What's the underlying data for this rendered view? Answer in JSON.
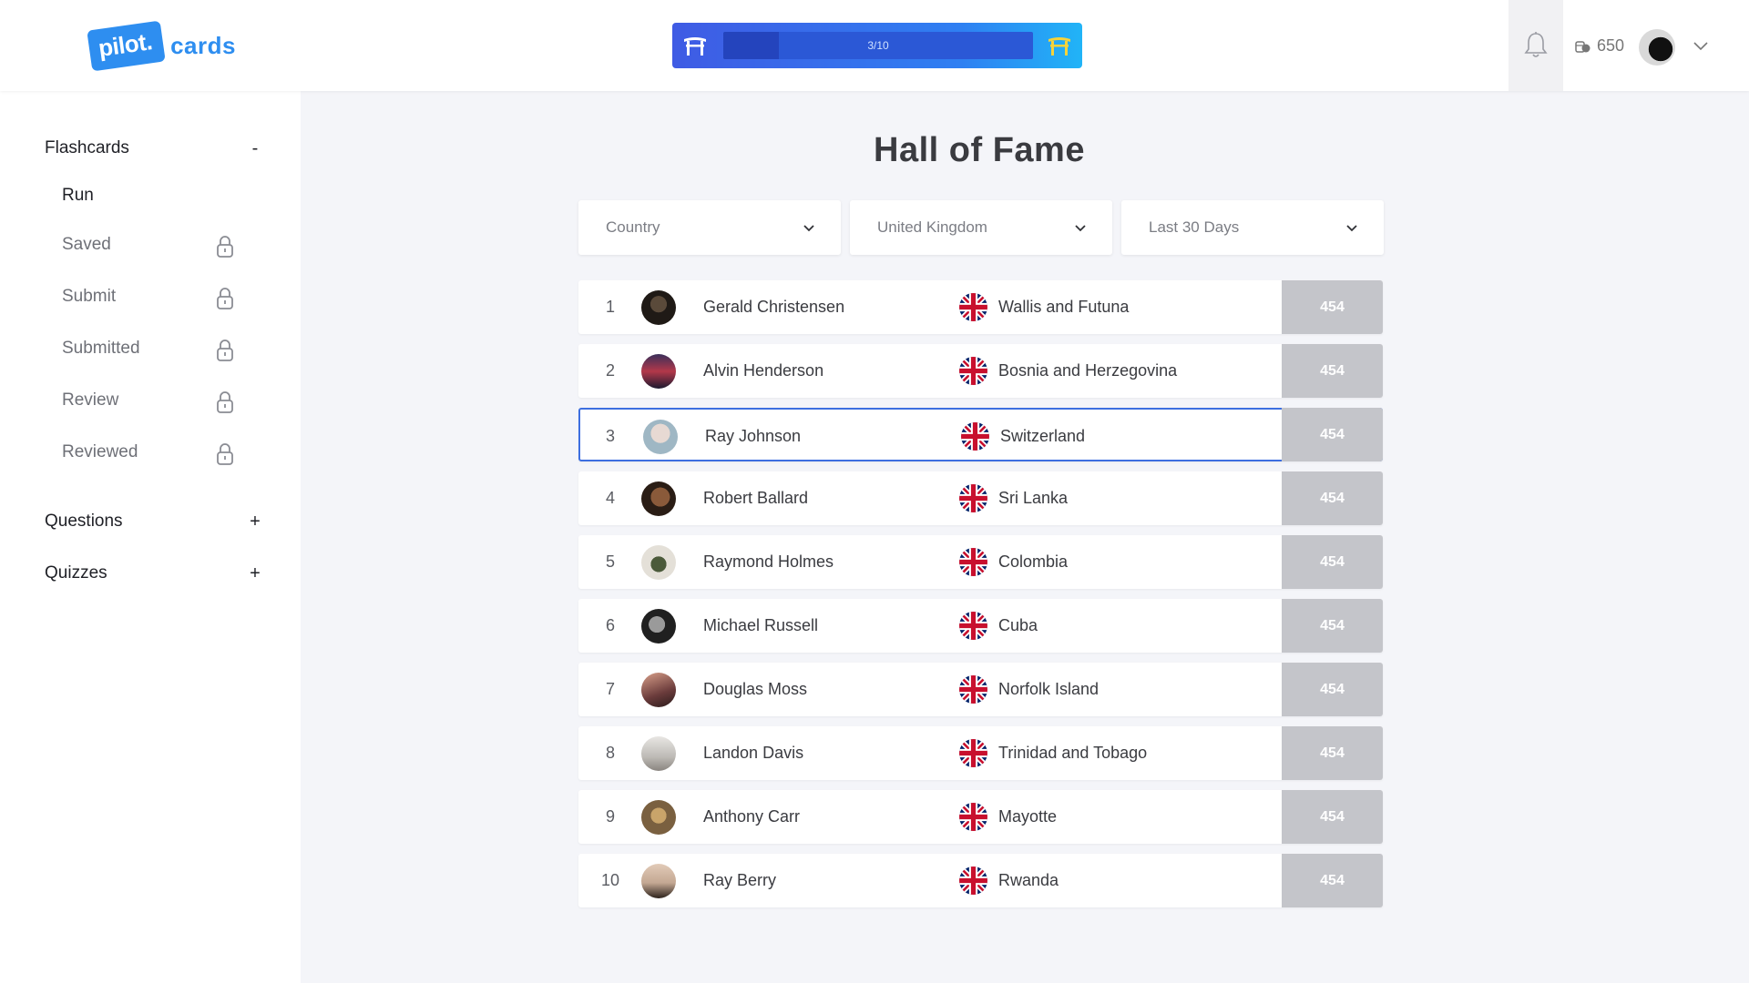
{
  "header": {
    "logo_badge": "pilot.",
    "logo_text": "cards",
    "progress": {
      "label": "3/10",
      "fraction": 0.18
    },
    "coins": "650"
  },
  "sidebar": {
    "sections": [
      {
        "label": "Flashcards",
        "toggle": "-"
      },
      {
        "label": "Questions",
        "toggle": "+"
      },
      {
        "label": "Quizzes",
        "toggle": "+"
      }
    ],
    "items": [
      {
        "label": "Run",
        "locked": false
      },
      {
        "label": "Saved",
        "locked": true
      },
      {
        "label": "Submit",
        "locked": true
      },
      {
        "label": "Submitted",
        "locked": true
      },
      {
        "label": "Review",
        "locked": true
      },
      {
        "label": "Reviewed",
        "locked": true
      }
    ]
  },
  "main": {
    "title": "Hall of Fame",
    "filters": [
      {
        "value": "Country"
      },
      {
        "value": "United Kingdom"
      },
      {
        "value": "Last 30 Days"
      }
    ],
    "rows": [
      {
        "rank": "1",
        "name": "Gerald Christensen",
        "country": "Wallis and Futuna",
        "score": "454"
      },
      {
        "rank": "2",
        "name": "Alvin Henderson",
        "country": "Bosnia and Herzegovina",
        "score": "454"
      },
      {
        "rank": "3",
        "name": "Ray Johnson",
        "country": "Switzerland",
        "score": "454"
      },
      {
        "rank": "4",
        "name": "Robert Ballard",
        "country": "Sri Lanka",
        "score": "454"
      },
      {
        "rank": "5",
        "name": "Raymond Holmes",
        "country": "Colombia",
        "score": "454"
      },
      {
        "rank": "6",
        "name": "Michael Russell",
        "country": "Cuba",
        "score": "454"
      },
      {
        "rank": "7",
        "name": "Douglas Moss",
        "country": "Norfolk Island",
        "score": "454"
      },
      {
        "rank": "8",
        "name": "Landon Davis",
        "country": "Trinidad and Tobago",
        "score": "454"
      },
      {
        "rank": "9",
        "name": "Anthony Carr",
        "country": "Mayotte",
        "score": "454"
      },
      {
        "rank": "10",
        "name": "Ray Berry",
        "country": "Rwanda",
        "score": "454"
      }
    ],
    "selected_rank": "3"
  },
  "colors": {
    "brand": "#2e8ef0",
    "selection": "#3d6fe0",
    "score_bg": "#c4c5ca"
  }
}
